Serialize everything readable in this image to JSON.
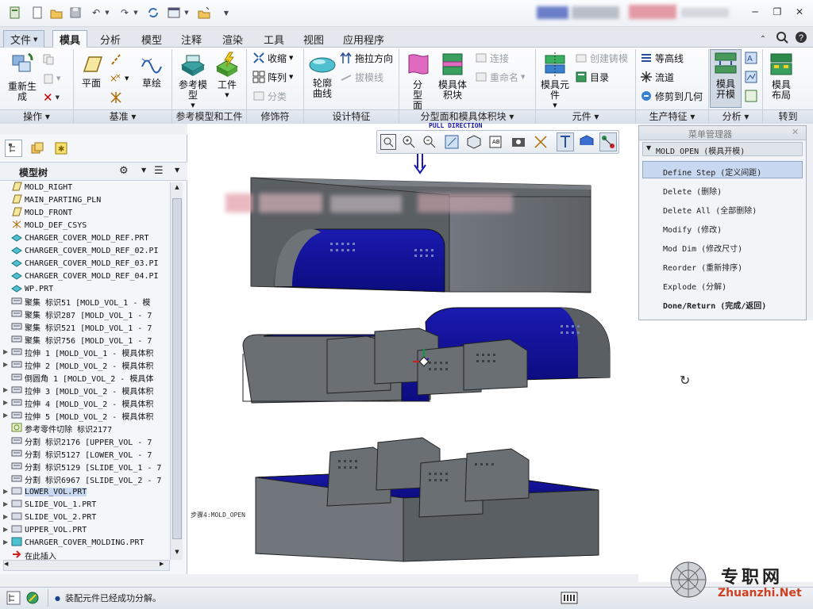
{
  "title_bar": {
    "quick_access": [
      "new-icon",
      "open-icon",
      "save-icon",
      "undo-icon",
      "redo-icon",
      "window-icon",
      "close-window-icon",
      "customize-icon"
    ],
    "window_controls": [
      "minimize-icon",
      "restore-icon",
      "close-icon"
    ]
  },
  "tabs": {
    "file": "文件",
    "items": [
      "模具",
      "分析",
      "模型",
      "注释",
      "渲染",
      "工具",
      "视图",
      "应用程序"
    ],
    "active": "模具"
  },
  "ribbon": {
    "groups": {
      "operation": "操作",
      "datum": "基准",
      "ref_model": "参考模型和工件",
      "modifier": "修饰符",
      "design_feature": "设计特征",
      "parting": "分型面和模具体积块",
      "component": "元件",
      "production": "生产特征",
      "analysis": "分析",
      "goto": "转到"
    },
    "regenerate": "重新生成",
    "plane": "平面",
    "sketch": "草绘",
    "ref_model": "参考模型",
    "workpiece": "工件",
    "shrink": "收缩",
    "pattern": "阵列",
    "classify": "分类",
    "silhouette_curve": "轮廓曲线",
    "draft_direction": "拖拉方向",
    "draft_line": "拔模线",
    "parting_surface": "分型面",
    "mold_volume": "模具体积块",
    "connect": "连接",
    "rename": "重命名",
    "mold_component": "模具元件",
    "create_casting": "创建铸模",
    "catalog": "目录",
    "contour_line": "等高线",
    "flow": "流道",
    "trim_to_geometry": "修剪到几何",
    "mold_open": "模具开模",
    "mold_layout": "模具布局"
  },
  "view_toolbar": [
    "zoom-fit-icon",
    "zoom-in-icon",
    "zoom-out-icon",
    "repaint-icon",
    "display-style-icon",
    "saved-views-icon",
    "view-manager-icon",
    "datum-display-icon",
    "spin-center-icon",
    "annotation-icon",
    "fill-icon",
    "node-icon"
  ],
  "model_tree": {
    "tabs": [
      "tree-icon",
      "layers-icon",
      "favorites-icon"
    ],
    "title": "模型树",
    "rows": [
      {
        "text": "MOLD_RIGHT",
        "icon": "plane",
        "expand": false
      },
      {
        "text": "MAIN_PARTING_PLN",
        "icon": "plane",
        "expand": false
      },
      {
        "text": "MOLD_FRONT",
        "icon": "plane",
        "expand": false
      },
      {
        "text": "MOLD_DEF_CSYS",
        "icon": "csys",
        "expand": false
      },
      {
        "text": "CHARGER_COVER_MOLD_REF.PRT",
        "icon": "part",
        "expand": false
      },
      {
        "text": "CHARGER_COVER_MOLD_REF_02.PI",
        "icon": "part",
        "expand": false
      },
      {
        "text": "CHARGER_COVER_MOLD_REF_03.PI",
        "icon": "part",
        "expand": false
      },
      {
        "text": "CHARGER_COVER_MOLD_REF_04.PI",
        "icon": "part",
        "expand": false
      },
      {
        "text": "WP.PRT",
        "icon": "part",
        "expand": false
      },
      {
        "text": "聚集 标识51 [MOLD_VOL_1 - 模",
        "icon": "feat",
        "expand": false
      },
      {
        "text": "聚集 标识287 [MOLD_VOL_1 - 7",
        "icon": "feat",
        "expand": false
      },
      {
        "text": "聚集 标识521 [MOLD_VOL_1 - 7",
        "icon": "feat",
        "expand": false
      },
      {
        "text": "聚集 标识756 [MOLD_VOL_1 - 7",
        "icon": "feat",
        "expand": false
      },
      {
        "text": "拉伸 1 [MOLD_VOL_1 - 模具体积",
        "icon": "feat",
        "expand": true
      },
      {
        "text": "拉伸 2 [MOLD_VOL_2 - 模具体积",
        "icon": "feat",
        "expand": true
      },
      {
        "text": "倒圆角 1 [MOLD_VOL_2 - 模具体",
        "icon": "feat",
        "expand": false
      },
      {
        "text": "拉伸 3 [MOLD_VOL_2 - 模具体积",
        "icon": "feat",
        "expand": true
      },
      {
        "text": "拉伸 4 [MOLD_VOL_2 - 模具体积",
        "icon": "feat",
        "expand": true
      },
      {
        "text": "拉伸 5 [MOLD_VOL_2 - 模具体积",
        "icon": "feat",
        "expand": true
      },
      {
        "text": "参考零件切除 标识2177",
        "icon": "cut",
        "expand": false
      },
      {
        "text": "分割 标识2176 [UPPER_VOL - 7",
        "icon": "feat",
        "expand": false
      },
      {
        "text": "分割 标识5127 [LOWER_VOL - 7",
        "icon": "feat",
        "expand": false
      },
      {
        "text": "分割 标识5129 [SLIDE_VOL_1 - 7",
        "icon": "feat",
        "expand": false
      },
      {
        "text": "分割 标识6967 [SLIDE_VOL_2 - 7",
        "icon": "feat",
        "expand": false
      },
      {
        "text": "LOWER_VOL.PRT",
        "icon": "vol",
        "expand": true,
        "selected": true
      },
      {
        "text": "SLIDE_VOL_1.PRT",
        "icon": "vol",
        "expand": true
      },
      {
        "text": "SLIDE_VOL_2.PRT",
        "icon": "vol",
        "expand": true
      },
      {
        "text": "UPPER_VOL.PRT",
        "icon": "vol",
        "expand": true
      },
      {
        "text": "CHARGER_COVER_MOLDING.PRT",
        "icon": "molding",
        "expand": true
      },
      {
        "text": "在此插入",
        "icon": "insert",
        "expand": false
      }
    ]
  },
  "graphics": {
    "pull_direction": "PULL DIRECTION",
    "step_label": "步骤4:MOLD_OPEN"
  },
  "menu_manager": {
    "title": "菜单管理器",
    "header": "MOLD OPEN (模具开模)",
    "items": [
      {
        "label": "Define Step (定义间距)",
        "highlight": true
      },
      {
        "label": "Delete (删除)"
      },
      {
        "label": "Delete All (全部删除)"
      },
      {
        "label": "Modify (修改)"
      },
      {
        "label": "Mod Dim (修改尺寸)"
      },
      {
        "label": "Reorder (重新排序)"
      },
      {
        "label": "Explode (分解)"
      },
      {
        "label": "Done/Return (完成/返回)",
        "bold": true
      }
    ]
  },
  "status_bar": {
    "message": "装配元件已经成功分解。"
  },
  "watermark": {
    "brand": "专职网",
    "url": "Zhuanzhi.Net"
  },
  "colors": {
    "mold_gray": "#666b70",
    "parting_blue": "#1a1ab0",
    "highlight": "#c7d8f0"
  }
}
